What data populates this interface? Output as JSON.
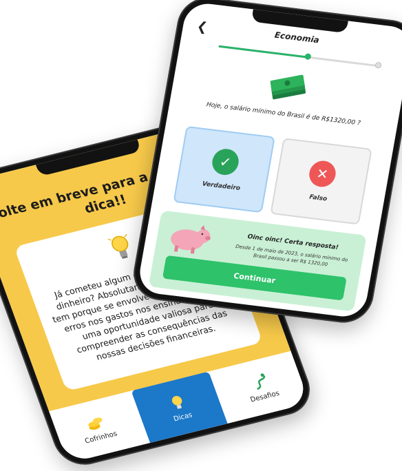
{
  "tips_screen": {
    "title": "Volte em breve para a próxima dica!!",
    "tip_text": "Já cometeu algum erro ao usar o seu dinheiro? Absolutamente normal! Isso tem porque se envolve... Esses pequenos erros nos gastos nos ensinam muito... uma oportunidade valiosa para compreender as consequências das nossas decisões financeiras.",
    "tabs": [
      {
        "label": "Cofrinhos",
        "icon": "coins-icon"
      },
      {
        "label": "Dicas",
        "icon": "lightbulb-icon"
      },
      {
        "label": "Desafios",
        "icon": "path-icon"
      }
    ],
    "active_tab": "Dicas",
    "colors": {
      "accent": "#f7c94a",
      "tab_active": "#1c78c8"
    }
  },
  "quiz_screen": {
    "title": "Economia",
    "progress": 0.55,
    "question": "Hoje, o salário mínimo do Brasil é de R$1320,00 ?",
    "options": [
      {
        "label": "Verdadeiro",
        "icon": "check-icon",
        "selected": true
      },
      {
        "label": "Falso",
        "icon": "x-icon",
        "selected": false
      }
    ],
    "feedback": {
      "title": "Oinc oinc! Certa resposta!",
      "body": "Desde 1 de maio de 2023, o salário mínimo do Brasil passou a ser R$ 1320,00"
    },
    "continue_label": "Continuar",
    "colors": {
      "success": "#2ec26a",
      "true_option": "#cfe6fb",
      "false_icon": "#ef5757"
    }
  }
}
